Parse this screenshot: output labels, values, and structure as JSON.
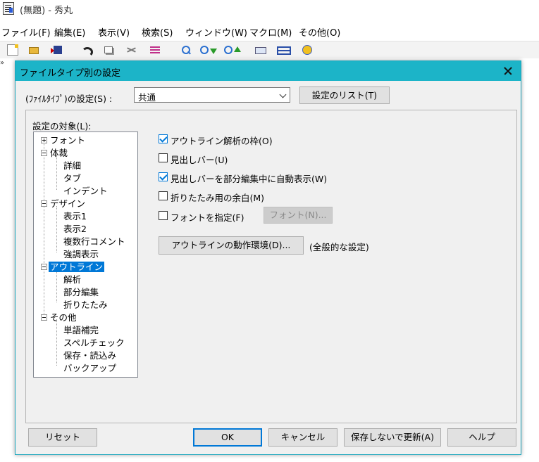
{
  "app": {
    "title": "(無題) - 秀丸"
  },
  "menubar": {
    "items": [
      "ファイル(F)",
      "編集(E)",
      "表示(V)",
      "検索(S)",
      "ウィンドウ(W)",
      "マクロ(M)",
      "その他(O)"
    ]
  },
  "toolbar": {
    "icons": [
      "new-file-icon",
      "open-folder-icon",
      "save-icon",
      "undo-icon",
      "copy-icon",
      "cut-icon",
      "paste-icon",
      "find-icon",
      "find-next-icon",
      "find-prev-icon",
      "window-icon",
      "split-window-icon",
      "macro-icon"
    ]
  },
  "ruler": {
    "mark": "»"
  },
  "dialog": {
    "title": "ファイルタイプ別の設定",
    "filetype_label": "(ﾌｧｲﾙﾀｲﾌﾟ)の設定(S) :",
    "filetype_value": "共通",
    "settings_list_button": "設定のリスト(T)",
    "target_label": "設定の対象(L):",
    "tree": [
      {
        "label": "フォント",
        "level": 0,
        "expander": "plus"
      },
      {
        "label": "体裁",
        "level": 0,
        "expander": "minus"
      },
      {
        "label": "詳細",
        "level": 1
      },
      {
        "label": "タブ",
        "level": 1
      },
      {
        "label": "インデント",
        "level": 1
      },
      {
        "label": "デザイン",
        "level": 0,
        "expander": "minus"
      },
      {
        "label": "表示1",
        "level": 1
      },
      {
        "label": "表示2",
        "level": 1
      },
      {
        "label": "複数行コメント",
        "level": 1
      },
      {
        "label": "強調表示",
        "level": 1
      },
      {
        "label": "アウトライン",
        "level": 0,
        "expander": "minus",
        "selected": true
      },
      {
        "label": "解析",
        "level": 1
      },
      {
        "label": "部分編集",
        "level": 1
      },
      {
        "label": "折りたたみ",
        "level": 1
      },
      {
        "label": "その他",
        "level": 0,
        "expander": "minus"
      },
      {
        "label": "単語補完",
        "level": 1
      },
      {
        "label": "スペルチェック",
        "level": 1
      },
      {
        "label": "保存・読込み",
        "level": 1
      },
      {
        "label": "バックアップ",
        "level": 1
      }
    ],
    "options": [
      {
        "label": "アウトライン解析の枠(O)",
        "checked": true
      },
      {
        "label": "見出しバー(U)",
        "checked": false
      },
      {
        "label": "見出しバーを部分編集中に自動表示(W)",
        "checked": true
      },
      {
        "label": "折りたたみ用の余白(M)",
        "checked": false
      },
      {
        "label": "フォントを指定(F)",
        "checked": false
      }
    ],
    "font_button": "フォント(N)...",
    "outline_env_button": "アウトラインの動作環境(D)...",
    "outline_env_note": "(全般的な設定)",
    "buttons": {
      "reset": "リセット",
      "ok": "OK",
      "cancel": "キャンセル",
      "update_no_save": "保存しないで更新(A)",
      "help": "ヘルプ"
    },
    "accent_color": "#1cb4c8",
    "selection_color": "#0078d7"
  }
}
